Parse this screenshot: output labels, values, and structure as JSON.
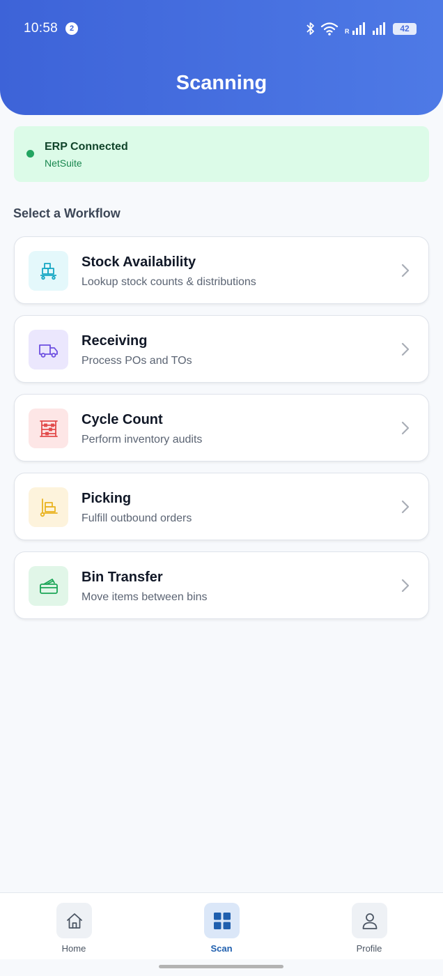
{
  "status_bar": {
    "time": "10:58",
    "notification_count": "2",
    "network_label": "R",
    "battery": "42"
  },
  "header": {
    "title": "Scanning"
  },
  "erp": {
    "title": "ERP Connected",
    "subtitle": "NetSuite",
    "status_color": "#22a561"
  },
  "section_title": "Select a Workflow",
  "workflows": [
    {
      "title": "Stock Availability",
      "subtitle": "Lookup stock counts & distributions",
      "icon": "package-cart-icon",
      "color": "#16a7c4",
      "bg": "#e4f8fb"
    },
    {
      "title": "Receiving",
      "subtitle": "Process POs and TOs",
      "icon": "truck-icon",
      "color": "#6d4fe0",
      "bg": "#ebe7fd"
    },
    {
      "title": "Cycle Count",
      "subtitle": "Perform inventory audits",
      "icon": "abacus-icon",
      "color": "#e24a4a",
      "bg": "#fde6e6"
    },
    {
      "title": "Picking",
      "subtitle": "Fulfill outbound orders",
      "icon": "hand-truck-icon",
      "color": "#e9b320",
      "bg": "#fdf3dc"
    },
    {
      "title": "Bin Transfer",
      "subtitle": "Move items between bins",
      "icon": "bin-transfer-icon",
      "color": "#1ba556",
      "bg": "#e1f6e8"
    }
  ],
  "nav": {
    "items": [
      {
        "label": "Home",
        "icon": "home-icon"
      },
      {
        "label": "Scan",
        "icon": "grid-icon"
      },
      {
        "label": "Profile",
        "icon": "user-icon"
      }
    ],
    "active_color": "#1f5fae",
    "inactive_color": "#4b5563"
  }
}
